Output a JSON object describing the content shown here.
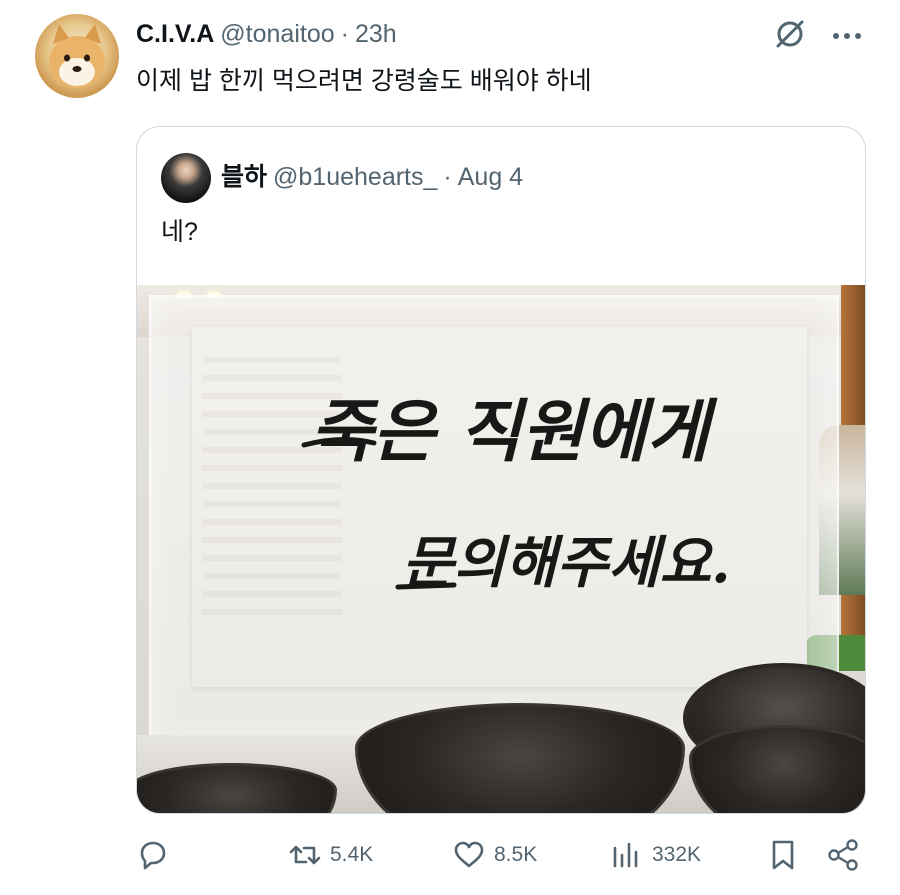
{
  "post": {
    "display_name": "C.I.V.A",
    "handle": "@tonaitoo",
    "separator": "·",
    "time": "23h",
    "text": "이제 밥 한끼 먹으려면 강령술도 배워야 하네"
  },
  "quoted_post": {
    "display_name": "블하",
    "handle": "@b1uehearts_",
    "separator": "·",
    "time": "Aug 4",
    "text": "네?",
    "image": {
      "sign_text_line1": "죽은 직원에게",
      "sign_text_line2": "문의해주세요."
    }
  },
  "actions": {
    "reply_count": "",
    "retweet_count": "5.4K",
    "like_count": "8.5K",
    "view_count": "332K"
  },
  "icons": [
    "grok-icon",
    "more-icon",
    "reply-icon",
    "retweet-icon",
    "like-icon",
    "views-icon",
    "bookmark-icon",
    "share-icon"
  ],
  "colors": {
    "text": "#0f1419",
    "secondary": "#536471",
    "border": "#cfd9de"
  }
}
